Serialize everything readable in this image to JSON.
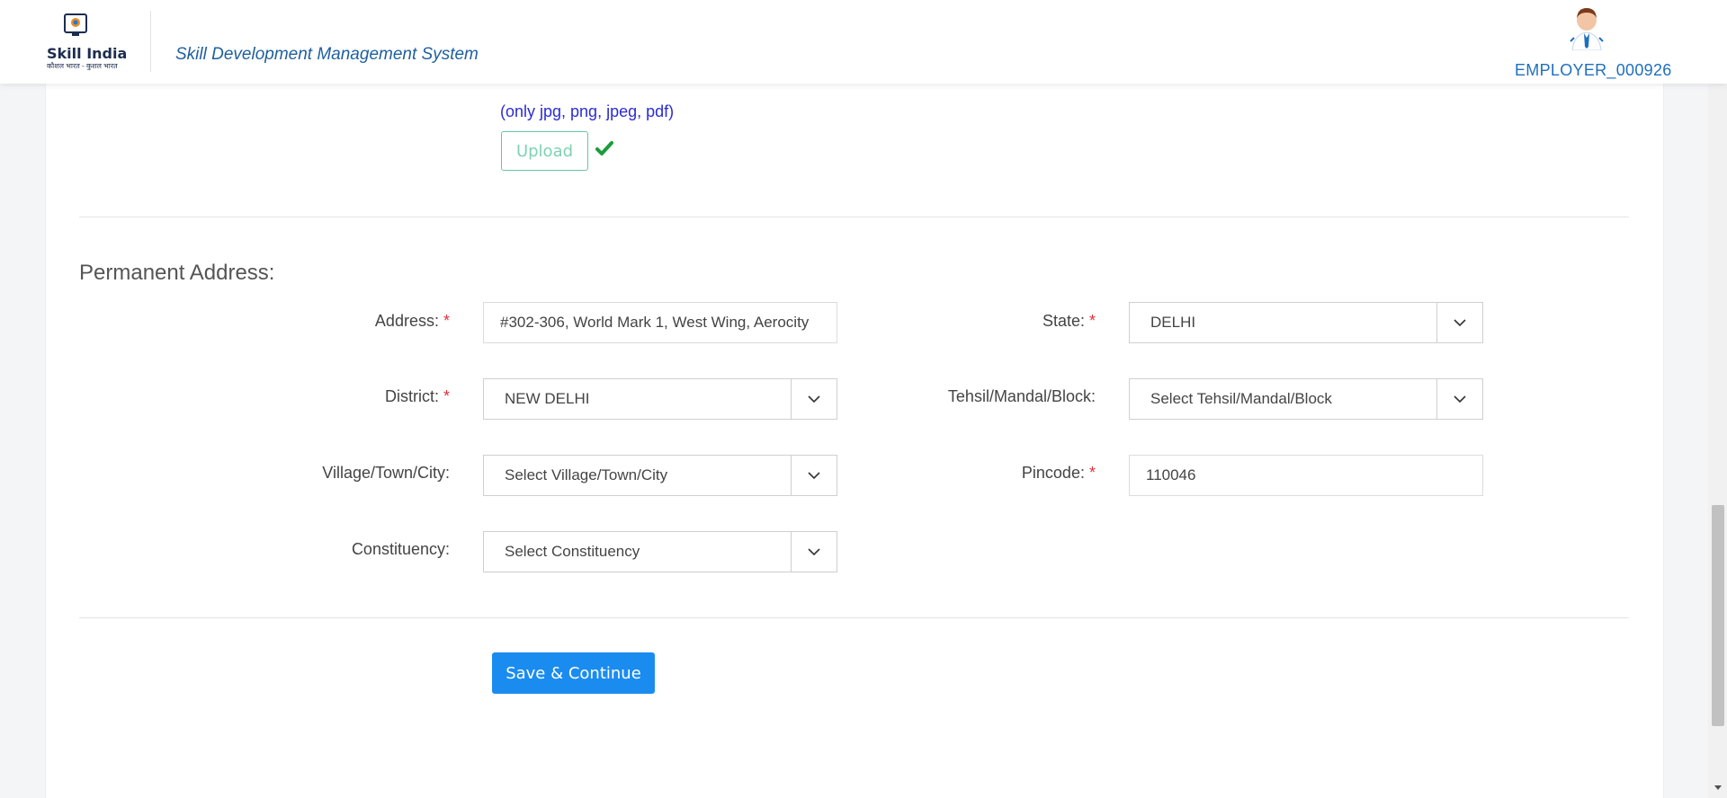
{
  "header": {
    "logo_text": "Skill India",
    "logo_subtext": "कौशल भारत - कुशल भारत",
    "app_title": "Skill Development Management System",
    "user_name": "EMPLOYER_000926"
  },
  "upload": {
    "file_types_hint": "(only jpg, png, jpeg, pdf)",
    "upload_label": "Upload"
  },
  "permanent_address": {
    "section_title": "Permanent Address:",
    "address_label": "Address:",
    "address_value": "#302-306, World Mark 1, West Wing, Aerocity",
    "state_label": "State:",
    "state_value": "DELHI",
    "district_label": "District:",
    "district_value": "NEW DELHI",
    "tehsil_label": "Tehsil/Mandal/Block:",
    "tehsil_value": "Select Tehsil/Mandal/Block",
    "village_label": "Village/Town/City:",
    "village_value": "Select Village/Town/City",
    "pincode_label": "Pincode:",
    "pincode_value": "110046",
    "constituency_label": "Constituency:",
    "constituency_value": "Select Constituency",
    "required_mark": "*"
  },
  "actions": {
    "save_continue_label": "Save & Continue"
  },
  "colors": {
    "primary": "#1a8cf0",
    "required": "#e0323a",
    "hint": "#2b2bd6",
    "upload_border": "#64c6a0",
    "check": "#1a9c3c"
  }
}
